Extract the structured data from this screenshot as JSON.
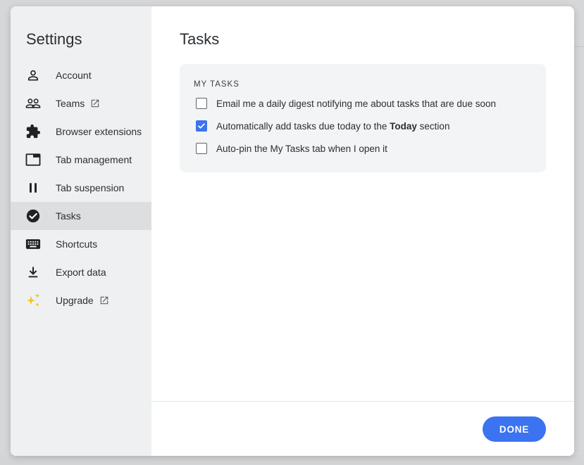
{
  "sidebar": {
    "title": "Settings",
    "items": [
      {
        "label": "Account",
        "icon": "person-icon",
        "external": false,
        "active": false
      },
      {
        "label": "Teams",
        "icon": "people-icon",
        "external": true,
        "active": false
      },
      {
        "label": "Browser extensions",
        "icon": "puzzle-icon",
        "external": false,
        "active": false
      },
      {
        "label": "Tab management",
        "icon": "tab-window-icon",
        "external": false,
        "active": false
      },
      {
        "label": "Tab suspension",
        "icon": "pause-icon",
        "external": false,
        "active": false
      },
      {
        "label": "Tasks",
        "icon": "check-circle-icon",
        "external": false,
        "active": true
      },
      {
        "label": "Shortcuts",
        "icon": "keyboard-icon",
        "external": false,
        "active": false
      },
      {
        "label": "Export data",
        "icon": "download-icon",
        "external": false,
        "active": false
      },
      {
        "label": "Upgrade",
        "icon": "sparkles-icon",
        "external": true,
        "active": false
      }
    ]
  },
  "main": {
    "title": "Tasks",
    "section": {
      "heading": "MY TASKS",
      "options": [
        {
          "label_before": "Email me a daily digest notifying me about tasks that are due soon",
          "label_bold": "",
          "label_after": "",
          "checked": false
        },
        {
          "label_before": "Automatically add tasks due today to the ",
          "label_bold": "Today",
          "label_after": " section",
          "checked": true
        },
        {
          "label_before": "Auto-pin the My Tasks tab when I open it",
          "label_bold": "",
          "label_after": "",
          "checked": false
        }
      ]
    }
  },
  "footer": {
    "done_label": "DONE"
  },
  "colors": {
    "accent": "#3b73f0",
    "sidebar_bg": "#eff0f1",
    "active_item_bg": "#dcdee0",
    "sparkle_yellow": "#f5c518"
  }
}
